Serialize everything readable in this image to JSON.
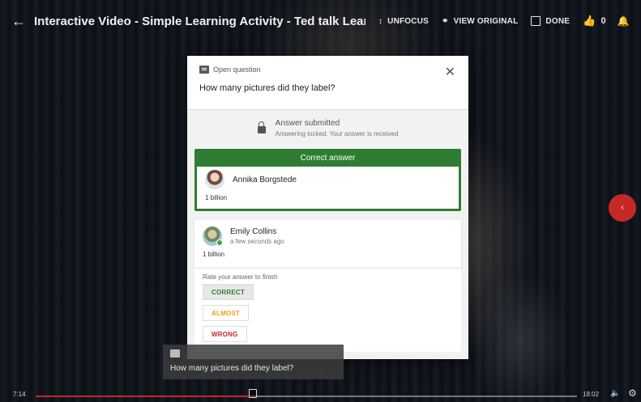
{
  "header": {
    "title": "Interactive Video - Simple Learning Activity - Ted talk Learning Activity",
    "actions": {
      "unfocus": "UNFOCUS",
      "view_original": "VIEW ORIGINAL",
      "done": "DONE",
      "likes": "0"
    }
  },
  "modal": {
    "question_type": "Open question",
    "question": "How many pictures did they label?",
    "locked": {
      "title": "Answer submitted",
      "subtitle": "Answering locked. Your answer is received"
    },
    "correct_answer": {
      "header": "Correct answer",
      "author": "Annika Borgstede",
      "answer": "1 billion"
    },
    "student_answer": {
      "author": "Emily Collins",
      "time": "a few seconds ago",
      "answer": "1 billion"
    },
    "rating": {
      "label": "Rate your answer to finish",
      "correct": "CORRECT",
      "almost": "ALMOST",
      "wrong": "WRONG"
    }
  },
  "caption": {
    "text": "How many pictures did they label?"
  },
  "player": {
    "current_time": "7:14",
    "duration": "18:02",
    "progress": 0.4
  },
  "icons": {
    "back": "arrow-left-icon",
    "unfocus": "collapse-icon",
    "view_original": "link-icon",
    "done": "checkbox-icon",
    "likes": "thumbs-up-icon",
    "notifications": "bell-icon",
    "side": "chevron-left-icon"
  },
  "colors": {
    "correct_green": "#2e7d32",
    "almost_orange": "#f29b1b",
    "wrong_red": "#c62828",
    "progress_red": "#c62828"
  }
}
